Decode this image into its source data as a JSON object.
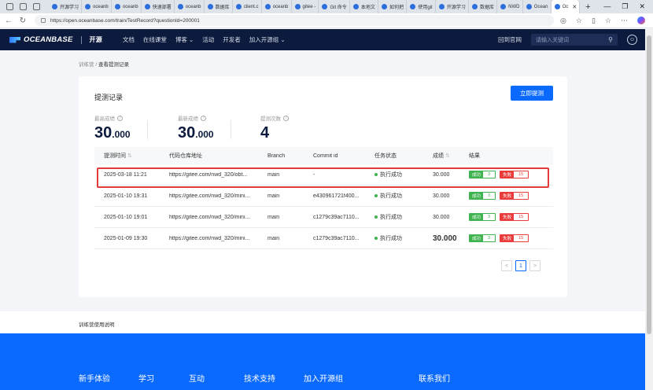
{
  "browser": {
    "tabs": [
      {
        "label": "开源学习"
      },
      {
        "label": "oceanb"
      },
      {
        "label": "oceanb"
      },
      {
        "label": "快速部署"
      },
      {
        "label": "oceanb"
      },
      {
        "label": "数据库"
      },
      {
        "label": "client.c"
      },
      {
        "label": "oceanb"
      },
      {
        "label": "gitee -"
      },
      {
        "label": "Git 命令"
      },
      {
        "label": "本地文"
      },
      {
        "label": "如何把"
      },
      {
        "label": "使用git"
      },
      {
        "label": "开源学习"
      },
      {
        "label": "数据库"
      },
      {
        "label": "NWD"
      },
      {
        "label": "Ocean"
      },
      {
        "label": "Oc",
        "active": true
      }
    ],
    "url": "https://open.oceanbase.com/train/TestRecord?questionId=200001"
  },
  "header": {
    "brand": "OCEANBASE",
    "brand_sub": "开源",
    "nav": [
      "文档",
      "在线课堂",
      "博客 ⌄",
      "活动",
      "开发者",
      "加入开源组 ⌄"
    ],
    "return_link": "回到官网",
    "search_placeholder": "请输入关键词"
  },
  "breadcrumb": {
    "parent": "训练营",
    "separator": "/",
    "current": "查看提测记录"
  },
  "card": {
    "title": "提测记录",
    "action_label": "立即提测",
    "stats": [
      {
        "label": "最高成绩",
        "value": "30",
        "decimals": ".000"
      },
      {
        "label": "最新成绩",
        "value": "30",
        "decimals": ".000"
      },
      {
        "label": "提测次数",
        "value": "4",
        "decimals": ""
      }
    ]
  },
  "table": {
    "columns": [
      "提测时间",
      "代码仓库地址",
      "Branch",
      "Commit id",
      "任务状态",
      "成绩",
      "结果"
    ],
    "rows": [
      {
        "time": "2025-03-18 11:21",
        "repo": "https://gitee.com/nwd_320/obt...",
        "branch": "main",
        "commit": "-",
        "status": "执行成功",
        "score": "30.000",
        "ok_label": "成功",
        "ok": "3",
        "fail_label": "失败",
        "fail": "15"
      },
      {
        "time": "2025-01-10 19:31",
        "repo": "https://gitee.com/nwd_320/mini...",
        "branch": "main",
        "commit": "e430961721f400...",
        "status": "执行成功",
        "score": "30.000",
        "ok_label": "成功",
        "ok": "3",
        "fail_label": "失败",
        "fail": "15"
      },
      {
        "time": "2025-01-10 19:01",
        "repo": "https://gitee.com/nwd_320/mini...",
        "branch": "main",
        "commit": "c1279c39ac7110...",
        "status": "执行成功",
        "score": "30.000",
        "ok_label": "成功",
        "ok": "3",
        "fail_label": "失败",
        "fail": "15"
      },
      {
        "time": "2025-01-09 19:30",
        "repo": "https://gitee.com/nwd_320/mini...",
        "branch": "main",
        "commit": "c1279c39ac7110...",
        "status": "执行成功",
        "score": "30.000",
        "ok_label": "成功",
        "ok": "3",
        "fail_label": "失败",
        "fail": "15"
      }
    ]
  },
  "pagination": {
    "current": "1",
    "prev": "<",
    "next": ">"
  },
  "help_text": "训练营使用说明",
  "footer": {
    "links": [
      "新手体验",
      "学习",
      "互动",
      "技术支持",
      "加入开源组",
      "联系我们"
    ]
  },
  "colors": {
    "primary": "#0a6aff",
    "header_bg": "#0b1a3d",
    "success": "#3fb34f",
    "fail": "#ea3b3b",
    "highlight": "#e23b3b"
  }
}
